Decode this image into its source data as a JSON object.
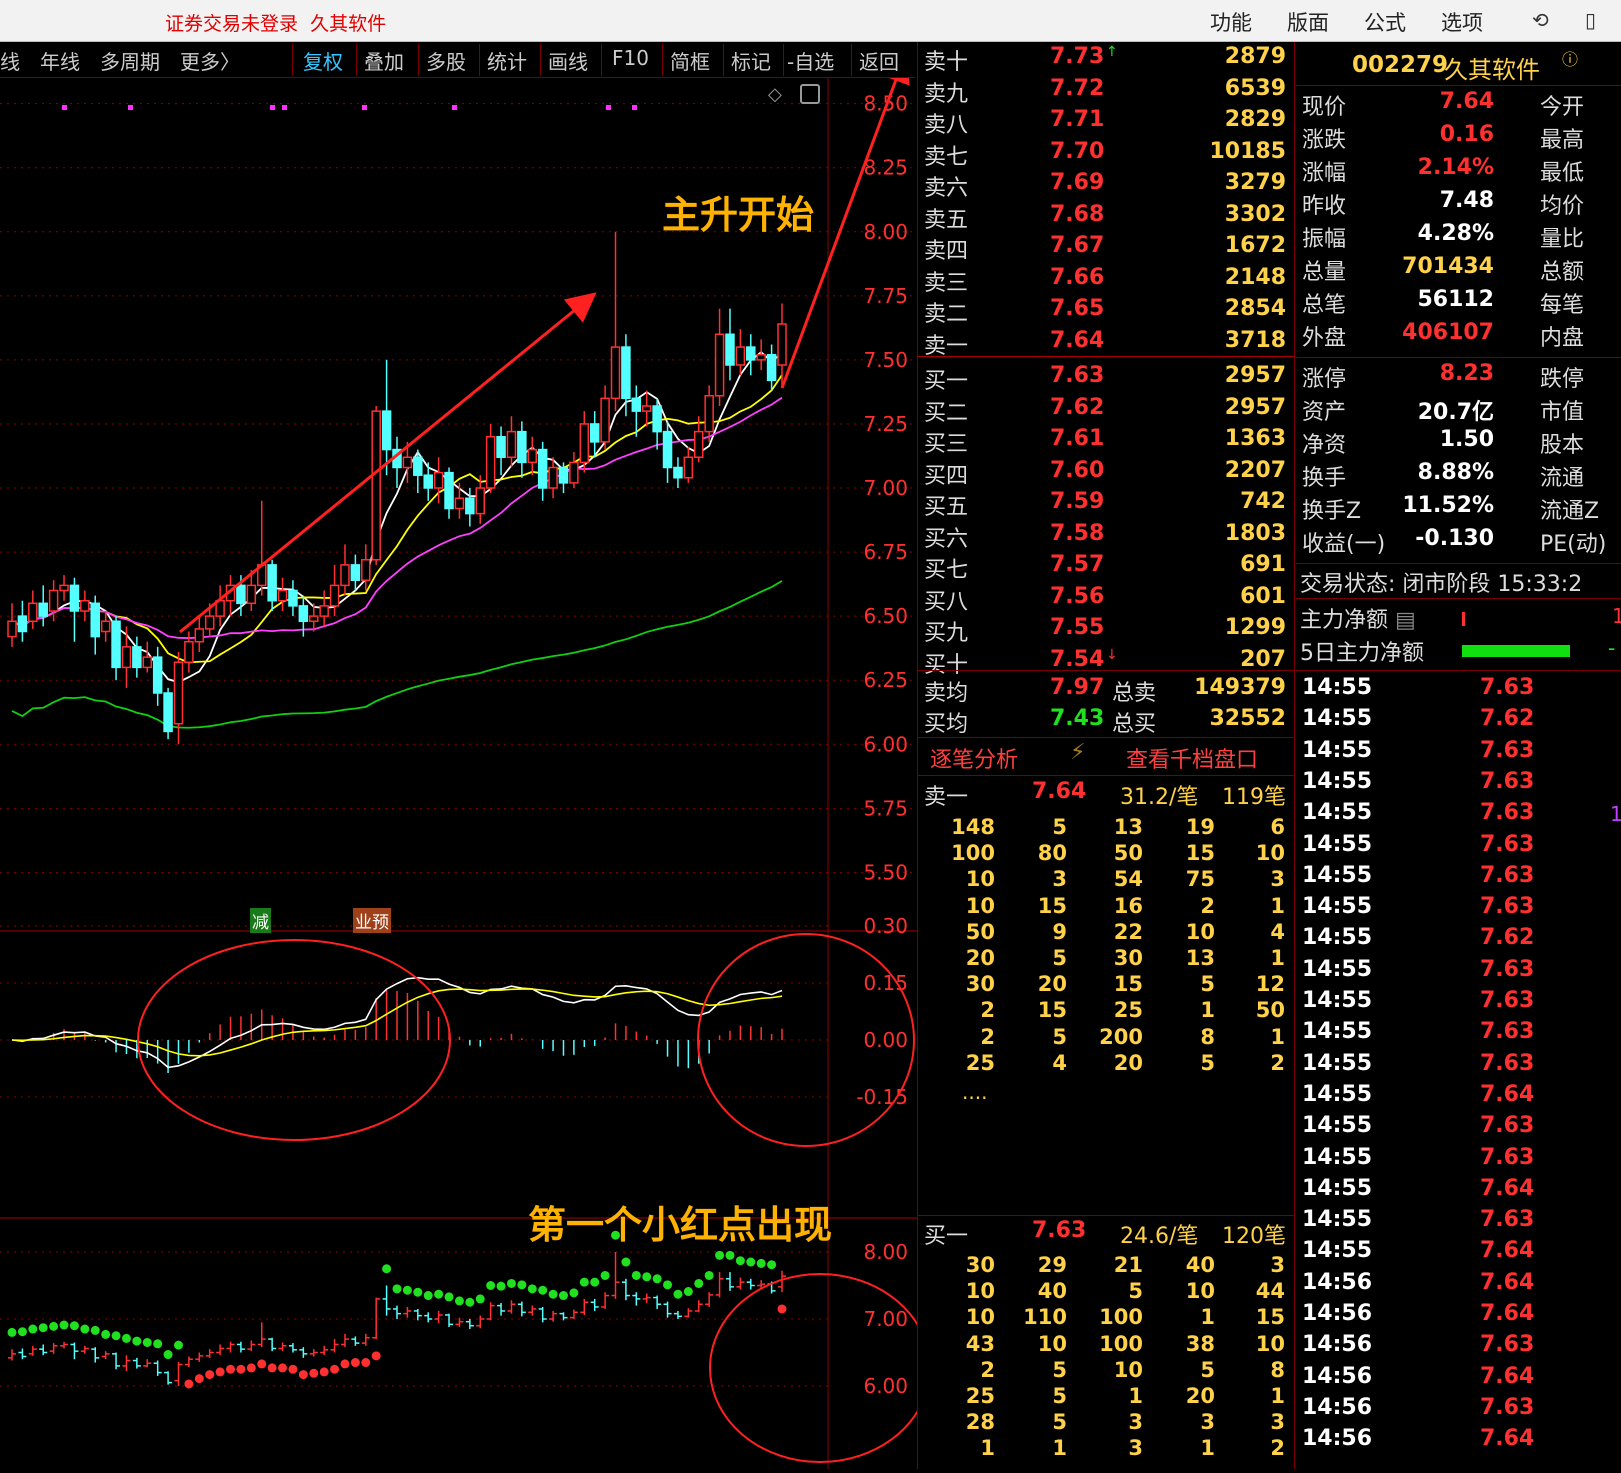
{
  "window": {
    "login_status": "证券交易未登录",
    "app_name": "久其软件",
    "menu": [
      "功能",
      "版面",
      "公式",
      "选项"
    ]
  },
  "toolbar": {
    "period_items": [
      "线",
      "年线",
      "多周期",
      "更多〉"
    ],
    "tool_items": [
      "复权",
      "叠加",
      "多股",
      "统计",
      "画线",
      "F10",
      "简框",
      "标记",
      "-自选",
      "返回"
    ],
    "active_tool": "复权"
  },
  "annotations": {
    "main_rise": "主升开始",
    "first_red_dot": "第一个小红点出现",
    "badge_reduce": "减",
    "badge_forecast": "业预"
  },
  "price_axis": [
    "8.50",
    "8.25",
    "8.00",
    "7.75",
    "7.50",
    "7.25",
    "7.00",
    "6.75",
    "6.50",
    "6.25",
    "6.00",
    "5.75",
    "5.50"
  ],
  "macd_axis": [
    "0.30",
    "0.15",
    "0.00",
    "-0.15"
  ],
  "sar_axis": [
    "8.00",
    "7.00",
    "6.00"
  ],
  "chart_data": {
    "type": "candlestick",
    "price_range": [
      5.4,
      8.6
    ],
    "candles": [
      {
        "o": 6.42,
        "c": 6.48,
        "h": 6.55,
        "l": 6.38
      },
      {
        "o": 6.5,
        "c": 6.44,
        "h": 6.56,
        "l": 6.4
      },
      {
        "o": 6.48,
        "c": 6.55,
        "h": 6.6,
        "l": 6.45
      },
      {
        "o": 6.55,
        "c": 6.5,
        "h": 6.62,
        "l": 6.46
      },
      {
        "o": 6.52,
        "c": 6.6,
        "h": 6.64,
        "l": 6.48
      },
      {
        "o": 6.6,
        "c": 6.62,
        "h": 6.66,
        "l": 6.56
      },
      {
        "o": 6.62,
        "c": 6.52,
        "h": 6.65,
        "l": 6.4
      },
      {
        "o": 6.52,
        "c": 6.56,
        "h": 6.6,
        "l": 6.48
      },
      {
        "o": 6.55,
        "c": 6.42,
        "h": 6.58,
        "l": 6.35
      },
      {
        "o": 6.44,
        "c": 6.48,
        "h": 6.52,
        "l": 6.4
      },
      {
        "o": 6.48,
        "c": 6.3,
        "h": 6.5,
        "l": 6.25
      },
      {
        "o": 6.3,
        "c": 6.38,
        "h": 6.46,
        "l": 6.22
      },
      {
        "o": 6.38,
        "c": 6.3,
        "h": 6.42,
        "l": 6.26
      },
      {
        "o": 6.3,
        "c": 6.34,
        "h": 6.4,
        "l": 6.28
      },
      {
        "o": 6.34,
        "c": 6.2,
        "h": 6.38,
        "l": 6.15
      },
      {
        "o": 6.2,
        "c": 6.05,
        "h": 6.22,
        "l": 6.02
      },
      {
        "o": 6.08,
        "c": 6.32,
        "h": 6.36,
        "l": 6.0
      },
      {
        "o": 6.32,
        "c": 6.4,
        "h": 6.44,
        "l": 6.28
      },
      {
        "o": 6.4,
        "c": 6.45,
        "h": 6.5,
        "l": 6.36
      },
      {
        "o": 6.45,
        "c": 6.5,
        "h": 6.55,
        "l": 6.42
      },
      {
        "o": 6.5,
        "c": 6.56,
        "h": 6.62,
        "l": 6.46
      },
      {
        "o": 6.56,
        "c": 6.62,
        "h": 6.66,
        "l": 6.5
      },
      {
        "o": 6.62,
        "c": 6.55,
        "h": 6.66,
        "l": 6.5
      },
      {
        "o": 6.55,
        "c": 6.62,
        "h": 6.68,
        "l": 6.52
      },
      {
        "o": 6.62,
        "c": 6.7,
        "h": 6.95,
        "l": 6.58
      },
      {
        "o": 6.7,
        "c": 6.56,
        "h": 6.72,
        "l": 6.52
      },
      {
        "o": 6.56,
        "c": 6.6,
        "h": 6.65,
        "l": 6.52
      },
      {
        "o": 6.6,
        "c": 6.54,
        "h": 6.64,
        "l": 6.5
      },
      {
        "o": 6.54,
        "c": 6.48,
        "h": 6.58,
        "l": 6.42
      },
      {
        "o": 6.48,
        "c": 6.5,
        "h": 6.55,
        "l": 6.44
      },
      {
        "o": 6.5,
        "c": 6.54,
        "h": 6.6,
        "l": 6.46
      },
      {
        "o": 6.54,
        "c": 6.62,
        "h": 6.7,
        "l": 6.5
      },
      {
        "o": 6.62,
        "c": 6.7,
        "h": 6.78,
        "l": 6.58
      },
      {
        "o": 6.7,
        "c": 6.64,
        "h": 6.74,
        "l": 6.6
      },
      {
        "o": 6.64,
        "c": 6.72,
        "h": 6.78,
        "l": 6.6
      },
      {
        "o": 6.72,
        "c": 7.3,
        "h": 7.32,
        "l": 6.7
      },
      {
        "o": 7.3,
        "c": 7.15,
        "h": 7.5,
        "l": 7.05
      },
      {
        "o": 7.15,
        "c": 7.08,
        "h": 7.2,
        "l": 7.0
      },
      {
        "o": 7.08,
        "c": 7.12,
        "h": 7.18,
        "l": 7.02
      },
      {
        "o": 7.12,
        "c": 7.05,
        "h": 7.15,
        "l": 6.98
      },
      {
        "o": 7.05,
        "c": 7.0,
        "h": 7.1,
        "l": 6.95
      },
      {
        "o": 7.0,
        "c": 7.06,
        "h": 7.12,
        "l": 6.94
      },
      {
        "o": 7.06,
        "c": 6.92,
        "h": 7.08,
        "l": 6.88
      },
      {
        "o": 6.92,
        "c": 6.96,
        "h": 7.02,
        "l": 6.88
      },
      {
        "o": 6.96,
        "c": 6.9,
        "h": 7.0,
        "l": 6.85
      },
      {
        "o": 6.9,
        "c": 7.0,
        "h": 7.05,
        "l": 6.86
      },
      {
        "o": 7.0,
        "c": 7.2,
        "h": 7.25,
        "l": 6.98
      },
      {
        "o": 7.2,
        "c": 7.12,
        "h": 7.24,
        "l": 7.05
      },
      {
        "o": 7.12,
        "c": 7.22,
        "h": 7.28,
        "l": 7.08
      },
      {
        "o": 7.22,
        "c": 7.1,
        "h": 7.26,
        "l": 7.04
      },
      {
        "o": 7.1,
        "c": 7.15,
        "h": 7.2,
        "l": 7.05
      },
      {
        "o": 7.15,
        "c": 7.0,
        "h": 7.18,
        "l": 6.95
      },
      {
        "o": 7.0,
        "c": 7.08,
        "h": 7.12,
        "l": 6.96
      },
      {
        "o": 7.08,
        "c": 7.02,
        "h": 7.1,
        "l": 6.98
      },
      {
        "o": 7.02,
        "c": 7.1,
        "h": 7.14,
        "l": 7.0
      },
      {
        "o": 7.1,
        "c": 7.25,
        "h": 7.3,
        "l": 7.06
      },
      {
        "o": 7.25,
        "c": 7.18,
        "h": 7.3,
        "l": 7.12
      },
      {
        "o": 7.18,
        "c": 7.35,
        "h": 7.4,
        "l": 7.15
      },
      {
        "o": 7.35,
        "c": 7.55,
        "h": 8.0,
        "l": 7.3
      },
      {
        "o": 7.55,
        "c": 7.35,
        "h": 7.6,
        "l": 7.28
      },
      {
        "o": 7.35,
        "c": 7.3,
        "h": 7.4,
        "l": 7.2
      },
      {
        "o": 7.3,
        "c": 7.32,
        "h": 7.38,
        "l": 7.24
      },
      {
        "o": 7.32,
        "c": 7.22,
        "h": 7.35,
        "l": 7.15
      },
      {
        "o": 7.22,
        "c": 7.08,
        "h": 7.26,
        "l": 7.02
      },
      {
        "o": 7.08,
        "c": 7.04,
        "h": 7.12,
        "l": 7.0
      },
      {
        "o": 7.04,
        "c": 7.12,
        "h": 7.16,
        "l": 7.02
      },
      {
        "o": 7.12,
        "c": 7.22,
        "h": 7.28,
        "l": 7.1
      },
      {
        "o": 7.22,
        "c": 7.36,
        "h": 7.4,
        "l": 7.18
      },
      {
        "o": 7.36,
        "c": 7.6,
        "h": 7.7,
        "l": 7.32
      },
      {
        "o": 7.6,
        "c": 7.48,
        "h": 7.7,
        "l": 7.42
      },
      {
        "o": 7.48,
        "c": 7.55,
        "h": 7.62,
        "l": 7.44
      },
      {
        "o": 7.55,
        "c": 7.5,
        "h": 7.6,
        "l": 7.44
      },
      {
        "o": 7.5,
        "c": 7.52,
        "h": 7.58,
        "l": 7.46
      },
      {
        "o": 7.52,
        "c": 7.42,
        "h": 7.56,
        "l": 7.38
      },
      {
        "o": 7.48,
        "c": 7.64,
        "h": 7.72,
        "l": 7.4
      }
    ]
  },
  "orderbook": {
    "sells": [
      {
        "label": "卖十",
        "price": "7.73",
        "vol": "2879",
        "mark": "↑"
      },
      {
        "label": "卖九",
        "price": "7.72",
        "vol": "6539"
      },
      {
        "label": "卖八",
        "price": "7.71",
        "vol": "2829"
      },
      {
        "label": "卖七",
        "price": "7.70",
        "vol": "10185"
      },
      {
        "label": "卖六",
        "price": "7.69",
        "vol": "3279"
      },
      {
        "label": "卖五",
        "price": "7.68",
        "vol": "3302"
      },
      {
        "label": "卖四",
        "price": "7.67",
        "vol": "1672"
      },
      {
        "label": "卖三",
        "price": "7.66",
        "vol": "2148"
      },
      {
        "label": "卖二",
        "price": "7.65",
        "vol": "2854"
      },
      {
        "label": "卖一",
        "price": "7.64",
        "vol": "3718"
      }
    ],
    "buys": [
      {
        "label": "买一",
        "price": "7.63",
        "vol": "2957"
      },
      {
        "label": "买二",
        "price": "7.62",
        "vol": "2957"
      },
      {
        "label": "买三",
        "price": "7.61",
        "vol": "1363"
      },
      {
        "label": "买四",
        "price": "7.60",
        "vol": "2207"
      },
      {
        "label": "买五",
        "price": "7.59",
        "vol": "742"
      },
      {
        "label": "买六",
        "price": "7.58",
        "vol": "1803"
      },
      {
        "label": "买七",
        "price": "7.57",
        "vol": "691"
      },
      {
        "label": "买八",
        "price": "7.56",
        "vol": "601"
      },
      {
        "label": "买九",
        "price": "7.55",
        "vol": "1299"
      },
      {
        "label": "买十",
        "price": "7.54",
        "vol": "207",
        "mark": "↓"
      }
    ],
    "avg_sell": {
      "label": "卖均",
      "price": "7.97",
      "total_label": "总卖",
      "total": "149379"
    },
    "avg_buy": {
      "label": "买均",
      "price": "7.43",
      "total_label": "总买",
      "total": "32552"
    }
  },
  "tick_analysis": {
    "tab_label": "逐笔分析",
    "link_label": "查看千档盘口",
    "sell_header": {
      "label": "卖一",
      "price": "7.64",
      "avg": "31.2/笔",
      "count": "119笔"
    },
    "sell_grid": [
      [
        "148",
        "5",
        "13",
        "19",
        "6"
      ],
      [
        "100",
        "80",
        "50",
        "15",
        "10"
      ],
      [
        "10",
        "3",
        "54",
        "75",
        "3"
      ],
      [
        "10",
        "15",
        "16",
        "2",
        "1"
      ],
      [
        "50",
        "9",
        "22",
        "10",
        "4"
      ],
      [
        "20",
        "5",
        "30",
        "13",
        "1"
      ],
      [
        "30",
        "20",
        "15",
        "5",
        "12"
      ],
      [
        "2",
        "15",
        "25",
        "1",
        "50"
      ],
      [
        "2",
        "5",
        "200",
        "8",
        "1"
      ],
      [
        "25",
        "4",
        "20",
        "5",
        "2"
      ]
    ],
    "more": "....",
    "buy_header": {
      "label": "买一",
      "price": "7.63",
      "avg": "24.6/笔",
      "count": "120笔"
    },
    "buy_grid": [
      [
        "30",
        "29",
        "21",
        "40",
        "3"
      ],
      [
        "10",
        "40",
        "5",
        "10",
        "44"
      ],
      [
        "10",
        "110",
        "100",
        "1",
        "15"
      ],
      [
        "43",
        "10",
        "100",
        "38",
        "10"
      ],
      [
        "2",
        "5",
        "10",
        "5",
        "8"
      ],
      [
        "25",
        "5",
        "1",
        "20",
        "1"
      ],
      [
        "28",
        "5",
        "3",
        "3",
        "3"
      ],
      [
        "1",
        "1",
        "3",
        "1",
        "2"
      ]
    ]
  },
  "quote": {
    "code": "002279",
    "name": "久其软件",
    "rows": [
      {
        "l": "现价",
        "v": "7.64",
        "c": "red",
        "r": "今开"
      },
      {
        "l": "涨跌",
        "v": "0.16",
        "c": "red",
        "r": "最高"
      },
      {
        "l": "涨幅",
        "v": "2.14%",
        "c": "red",
        "r": "最低"
      },
      {
        "l": "昨收",
        "v": "7.48",
        "c": "wht",
        "r": "均价"
      },
      {
        "l": "振幅",
        "v": "4.28%",
        "c": "wht",
        "r": "量比"
      },
      {
        "l": "总量",
        "v": "701434",
        "c": "yel",
        "r": "总额"
      },
      {
        "l": "总笔",
        "v": "56112",
        "c": "wht",
        "r": "每笔"
      },
      {
        "l": "外盘",
        "v": "406107",
        "c": "red",
        "r": "内盘"
      }
    ],
    "rows2": [
      {
        "l": "涨停",
        "v": "8.23",
        "c": "red",
        "r": "跌停"
      },
      {
        "l": "资产",
        "v": "20.7亿",
        "c": "wht",
        "r": "市值"
      },
      {
        "l": "净资",
        "v": "1.50",
        "c": "wht",
        "r": "股本"
      },
      {
        "l": "换手",
        "v": "8.88%",
        "c": "wht",
        "r": "流通"
      },
      {
        "l": "换手Z",
        "v": "11.52%",
        "c": "wht",
        "r": "流通Z"
      },
      {
        "l": "收益(一)",
        "v": "-0.130",
        "c": "wht",
        "r": "PE(动)"
      }
    ],
    "trade_status": "交易状态: 闭市阶段 15:33:2",
    "main_net": "主力净额",
    "main_net5": "5日主力净额"
  },
  "ticks": [
    {
      "t": "14:55",
      "p": "7.63"
    },
    {
      "t": "14:55",
      "p": "7.62"
    },
    {
      "t": "14:55",
      "p": "7.63"
    },
    {
      "t": "14:55",
      "p": "7.63"
    },
    {
      "t": "14:55",
      "p": "7.63"
    },
    {
      "t": "14:55",
      "p": "7.63"
    },
    {
      "t": "14:55",
      "p": "7.63"
    },
    {
      "t": "14:55",
      "p": "7.63"
    },
    {
      "t": "14:55",
      "p": "7.62"
    },
    {
      "t": "14:55",
      "p": "7.63"
    },
    {
      "t": "14:55",
      "p": "7.63"
    },
    {
      "t": "14:55",
      "p": "7.63"
    },
    {
      "t": "14:55",
      "p": "7.63"
    },
    {
      "t": "14:55",
      "p": "7.64"
    },
    {
      "t": "14:55",
      "p": "7.63"
    },
    {
      "t": "14:55",
      "p": "7.63"
    },
    {
      "t": "14:55",
      "p": "7.64"
    },
    {
      "t": "14:55",
      "p": "7.63"
    },
    {
      "t": "14:55",
      "p": "7.64"
    },
    {
      "t": "14:56",
      "p": "7.64"
    },
    {
      "t": "14:56",
      "p": "7.64"
    },
    {
      "t": "14:56",
      "p": "7.63"
    },
    {
      "t": "14:56",
      "p": "7.64"
    },
    {
      "t": "14:56",
      "p": "7.63"
    },
    {
      "t": "14:56",
      "p": "7.64"
    }
  ]
}
